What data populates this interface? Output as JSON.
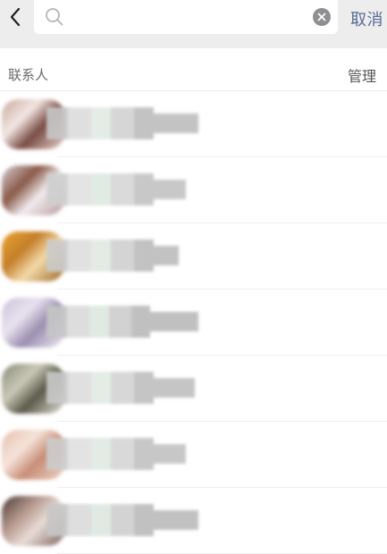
{
  "search": {
    "value": "",
    "placeholder": "",
    "cancel_label": "取消"
  },
  "section": {
    "title": "联系人",
    "manage_label": "管理"
  },
  "icons": {
    "back": "chevron-left-icon",
    "search": "magnifier-icon",
    "clear": "close-circle-icon"
  },
  "colors": {
    "link_blue": "#576b95",
    "search_bg": "#ededed",
    "clear_icon": "#8e8e93"
  },
  "contacts": [
    {
      "avatar_colors": [
        "#c9a89d",
        "#f2e6e2",
        "#7a4d45",
        "#e7d2cb"
      ],
      "name_shades": [
        "#c8c8c8",
        "#dcdcdc",
        "#e0ece4",
        "#d2d2d2",
        "#bdbdbd"
      ]
    },
    {
      "avatar_colors": [
        "#d9d0d6",
        "#8a5a4a",
        "#f1ebee",
        "#b79a9a"
      ],
      "name_shades": [
        "#cfcfcf",
        "#e2e2e2",
        "#dde9e1",
        "#d6d6d6",
        "#c3c3c3"
      ]
    },
    {
      "avatar_colors": [
        "#e9a42f",
        "#c47f2a",
        "#f3d9a8",
        "#9c6a2a"
      ],
      "name_shades": [
        "#cbcbcb",
        "#dedede",
        "#dfeae3",
        "#d0d0d0",
        "#bcbcbc"
      ]
    },
    {
      "avatar_colors": [
        "#cdc4da",
        "#e8e2ef",
        "#9b8fb0",
        "#f2eef5"
      ],
      "name_shades": [
        "#c6c6c6",
        "#dadada",
        "#dde8e0",
        "#cecece",
        "#bababa"
      ]
    },
    {
      "avatar_colors": [
        "#8a8a78",
        "#c9c8b6",
        "#5c5b4c",
        "#e4e3d8"
      ],
      "name_shades": [
        "#c9c9c9",
        "#dddddd",
        "#e0ebe3",
        "#d3d3d3",
        "#bfbfbf"
      ]
    },
    {
      "avatar_colors": [
        "#e6c0ad",
        "#f5e3da",
        "#c88e78",
        "#eed4c6"
      ],
      "name_shades": [
        "#cdcdcd",
        "#e1e1e1",
        "#dfe9e2",
        "#d5d5d5",
        "#c2c2c2"
      ]
    },
    {
      "avatar_colors": [
        "#4a3a35",
        "#b79a8f",
        "#e8dcd6",
        "#7b625a"
      ],
      "name_shades": [
        "#c7c7c7",
        "#dbdbdb",
        "#dde8e0",
        "#cfcfcf",
        "#bbbbbb"
      ]
    }
  ]
}
